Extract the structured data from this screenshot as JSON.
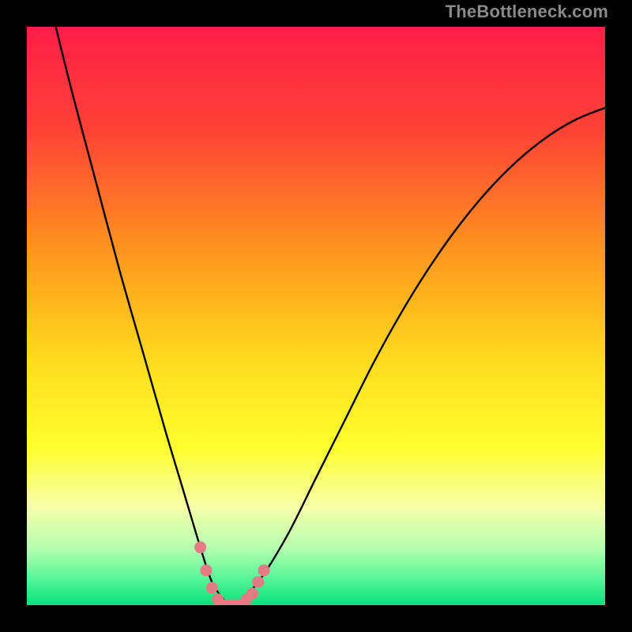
{
  "watermark": "TheBottleneck.com",
  "chart_data": {
    "type": "line",
    "title": "",
    "xlabel": "",
    "ylabel": "",
    "xlim": [
      0,
      100
    ],
    "ylim": [
      0,
      100
    ],
    "gradient_stops": [
      {
        "offset": 0,
        "color": "#ff1e4a"
      },
      {
        "offset": 0.18,
        "color": "#ff4236"
      },
      {
        "offset": 0.4,
        "color": "#ff9a1e"
      },
      {
        "offset": 0.58,
        "color": "#ffdc1e"
      },
      {
        "offset": 0.73,
        "color": "#ffff30"
      },
      {
        "offset": 0.83,
        "color": "#f6ffa8"
      },
      {
        "offset": 0.9,
        "color": "#b8ffb0"
      },
      {
        "offset": 0.955,
        "color": "#55f598"
      },
      {
        "offset": 1.0,
        "color": "#06e27a"
      }
    ],
    "series": [
      {
        "name": "bottleneck-curve",
        "x": [
          5,
          8,
          12,
          16,
          20,
          24,
          27,
          30,
          32,
          34,
          35,
          36,
          40,
          45,
          50,
          55,
          60,
          65,
          70,
          75,
          80,
          85,
          90,
          95,
          100
        ],
        "y": [
          100,
          88,
          73,
          58,
          44,
          30,
          20,
          10,
          4,
          1,
          0,
          0,
          4,
          12,
          22,
          32,
          42,
          51,
          59,
          66,
          72,
          77,
          81,
          84,
          86
        ]
      }
    ],
    "highlight": {
      "name": "optimal-zone",
      "color": "#e37b83",
      "points": [
        {
          "x": 30,
          "y": 10
        },
        {
          "x": 31,
          "y": 6
        },
        {
          "x": 32,
          "y": 3
        },
        {
          "x": 33,
          "y": 1
        },
        {
          "x": 34,
          "y": 0
        },
        {
          "x": 35,
          "y": 0
        },
        {
          "x": 36,
          "y": 0
        },
        {
          "x": 37,
          "y": 0
        },
        {
          "x": 38,
          "y": 1
        },
        {
          "x": 39,
          "y": 2
        },
        {
          "x": 40,
          "y": 4
        },
        {
          "x": 41,
          "y": 6
        }
      ]
    }
  }
}
